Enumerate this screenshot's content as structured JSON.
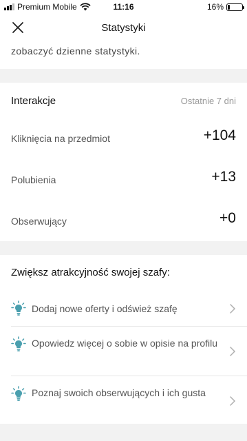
{
  "status_bar": {
    "carrier": "Premium Mobile",
    "time": "11:16",
    "battery": "16%",
    "battery_level": 0.16
  },
  "nav": {
    "title": "Statystyki",
    "close_icon": "close-icon"
  },
  "intro": {
    "text": "zobaczyć dzienne statystyki."
  },
  "interactions": {
    "title": "Interakcje",
    "period": "Ostatnie 7 dni",
    "rows": [
      {
        "label": "Kliknięcia na przedmiot",
        "value": "+104"
      },
      {
        "label": "Polubienia",
        "value": "+13"
      },
      {
        "label": "Obserwujący",
        "value": "+0"
      }
    ]
  },
  "tips": {
    "title": "Zwiększ atrakcyjność swojej szafy:",
    "icon": "lightbulb-icon",
    "accent": "#4a9fae",
    "items": [
      {
        "text": "Dodaj nowe oferty i odśwież szafę"
      },
      {
        "text": "Opowiedz więcej o sobie w opisie na profilu"
      },
      {
        "text": "Poznaj swoich obserwujących i ich gusta"
      }
    ]
  }
}
